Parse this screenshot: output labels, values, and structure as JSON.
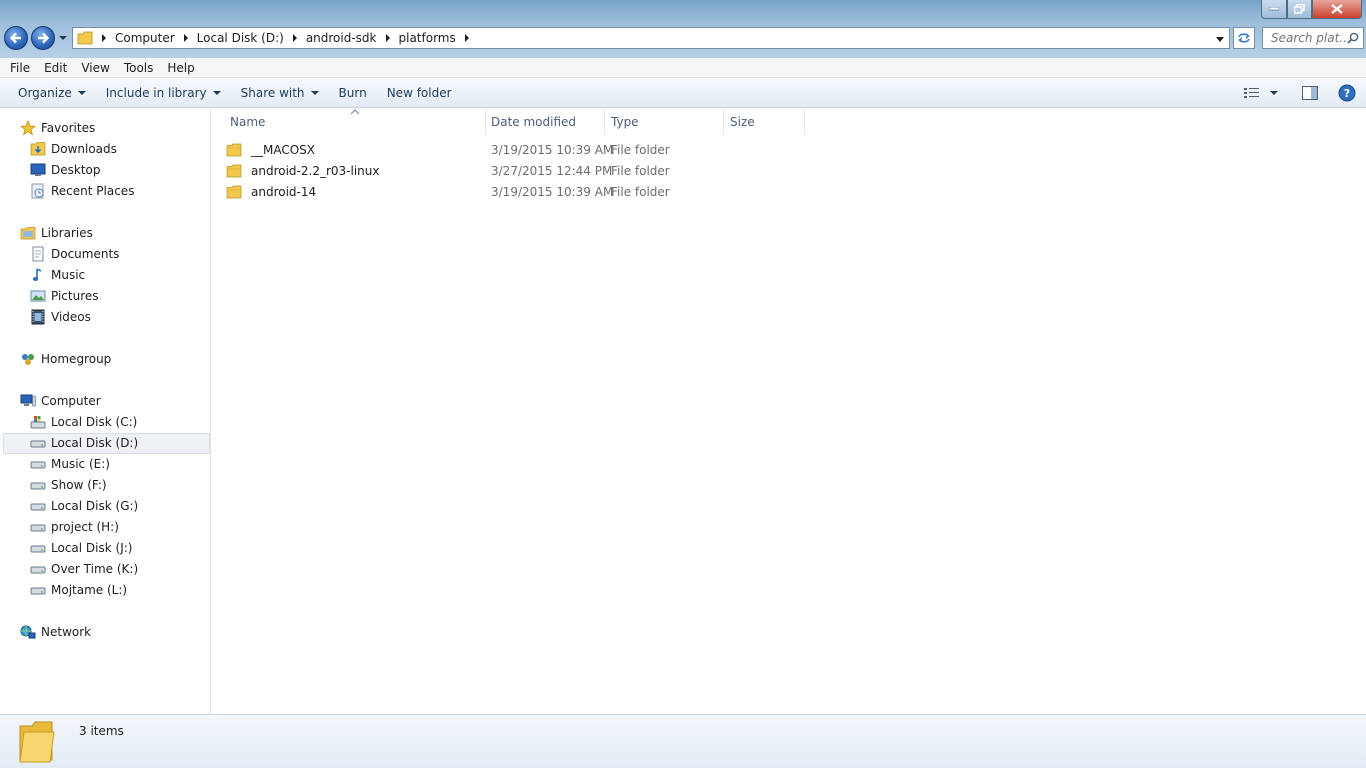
{
  "window": {
    "breadcrumbs": [
      "Computer",
      "Local Disk (D:)",
      "android-sdk",
      "platforms"
    ],
    "search_placeholder": "Search plat...",
    "colors": {
      "accent": "#2a64b8",
      "close": "#c9402f",
      "folder": "#f2c94c"
    }
  },
  "menubar": {
    "items": [
      "File",
      "Edit",
      "View",
      "Tools",
      "Help"
    ]
  },
  "toolbar": {
    "organize": "Organize",
    "include_in_library": "Include in library",
    "share_with": "Share with",
    "burn": "Burn",
    "new_folder": "New folder"
  },
  "navpane": {
    "favorites": {
      "label": "Favorites",
      "items": [
        "Downloads",
        "Desktop",
        "Recent Places"
      ]
    },
    "libraries": {
      "label": "Libraries",
      "items": [
        "Documents",
        "Music",
        "Pictures",
        "Videos"
      ]
    },
    "homegroup": "Homegroup",
    "computer": {
      "label": "Computer",
      "items": [
        "Local Disk (C:)",
        "Local Disk (D:)",
        "Music (E:)",
        "Show (F:)",
        "Local Disk (G:)",
        "project (H:)",
        "Local Disk (J:)",
        "Over Time (K:)",
        "Mojtame (L:)"
      ],
      "selected": "Local Disk (D:)"
    },
    "network": "Network"
  },
  "files": {
    "columns": [
      "Name",
      "Date modified",
      "Type",
      "Size"
    ],
    "rows": [
      {
        "name": "__MACOSX",
        "date": "3/19/2015 10:39 AM",
        "type": "File folder",
        "size": ""
      },
      {
        "name": "android-2.2_r03-linux",
        "date": "3/27/2015 12:44 PM",
        "type": "File folder",
        "size": ""
      },
      {
        "name": "android-14",
        "date": "3/19/2015 10:39 AM",
        "type": "File folder",
        "size": ""
      }
    ]
  },
  "status": {
    "item_count": "3 items"
  }
}
